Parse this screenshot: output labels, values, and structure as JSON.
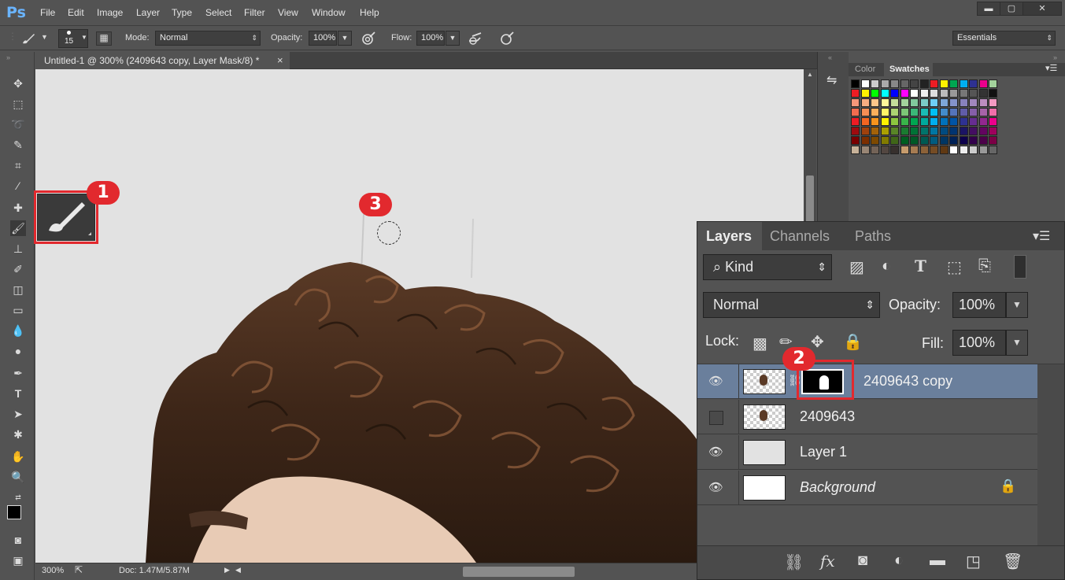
{
  "app": {
    "logo": "Ps"
  },
  "menu": [
    "File",
    "Edit",
    "Image",
    "Layer",
    "Type",
    "Select",
    "Filter",
    "View",
    "Window",
    "Help"
  ],
  "window_controls": {
    "minimize": "▬",
    "restore": "▢",
    "close": "✕"
  },
  "options_bar": {
    "brush_size": "15",
    "mode_label": "Mode:",
    "mode_value": "Normal",
    "opacity_label": "Opacity:",
    "opacity_value": "100%",
    "flow_label": "Flow:",
    "flow_value": "100%",
    "workspace": "Essentials"
  },
  "document_tab": {
    "title": "Untitled-1 @ 300% (2409643 copy, Layer Mask/8) *",
    "close": "×"
  },
  "status": {
    "zoom": "300%",
    "doc": "Doc: 1.47M/5.87M"
  },
  "swatch_panel": {
    "tabs": [
      "Color",
      "Swatches"
    ]
  },
  "layers_panel": {
    "tabs": [
      "Layers",
      "Channels",
      "Paths"
    ],
    "filter_kind": "Kind",
    "blend_mode": "Normal",
    "opacity_label": "Opacity:",
    "opacity_value": "100%",
    "lock_label": "Lock:",
    "fill_label": "Fill:",
    "fill_value": "100%",
    "layers": [
      {
        "name": "2409643 copy",
        "visible": true,
        "selected": true
      },
      {
        "name": "2409643",
        "visible": false,
        "selected": false
      },
      {
        "name": "Layer 1",
        "visible": true,
        "selected": false
      },
      {
        "name": "Background",
        "visible": true,
        "selected": false
      }
    ]
  },
  "annotations": {
    "b1": "1",
    "b2": "2",
    "b3": "3"
  },
  "colors": {
    "accent": "#e2292e",
    "selected_layer": "#6a7f9c",
    "panel": "#535353"
  }
}
